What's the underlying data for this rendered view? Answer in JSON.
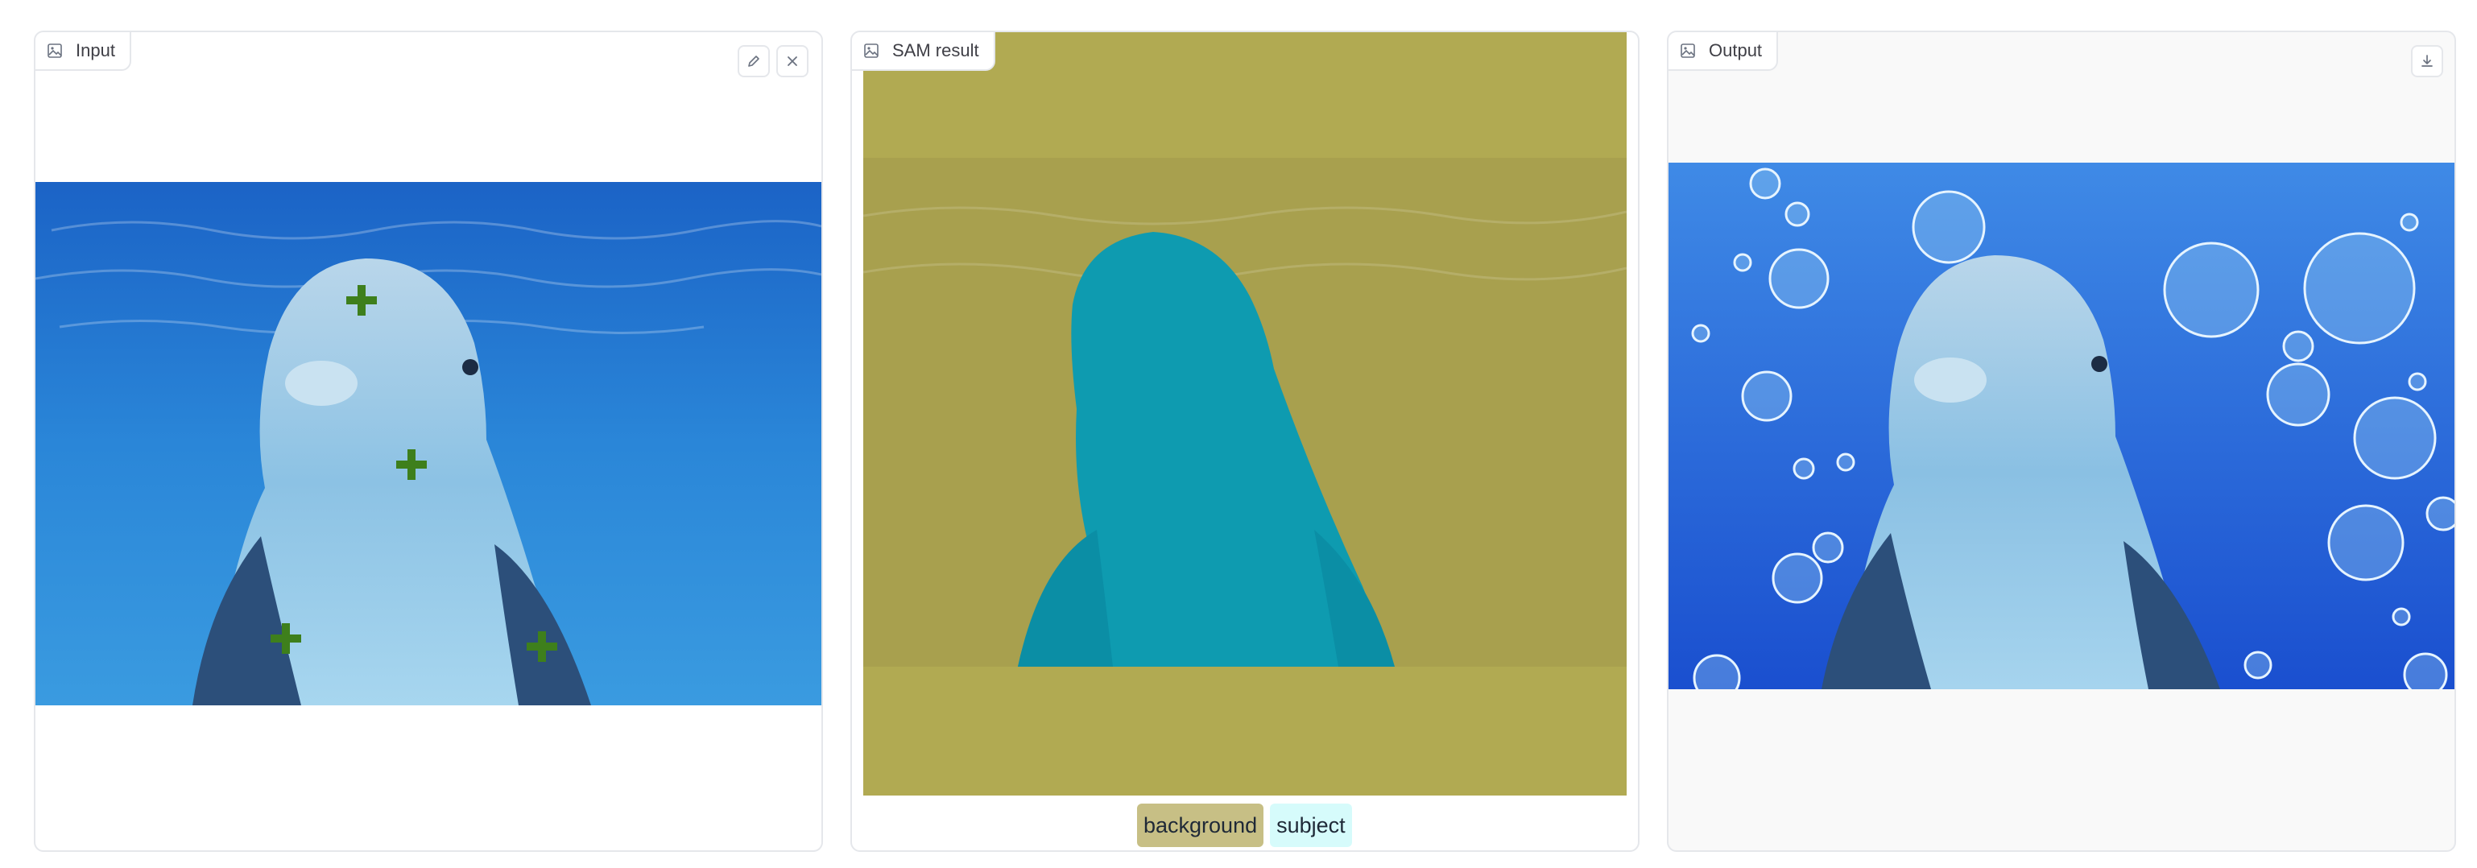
{
  "panels": {
    "input": {
      "label": "Input",
      "icon": "image-icon"
    },
    "sam": {
      "label": "SAM result",
      "icon": "image-icon"
    },
    "output": {
      "label": "Output",
      "icon": "image-icon"
    }
  },
  "toolbar": {
    "edit_icon": "pencil-icon",
    "clear_icon": "close-icon",
    "download_icon": "download-icon"
  },
  "legend": {
    "items": [
      {
        "label": "background",
        "color": "#c7bf85"
      },
      {
        "label": "subject",
        "color": "#d6fbfb"
      }
    ]
  },
  "colors": {
    "water": "#1f6fc9",
    "mask_background": "#b1aa52",
    "mask_subject": "#0e9bb0",
    "point_marker": "#3e7f1c",
    "output_bg": "#2c6fde"
  }
}
